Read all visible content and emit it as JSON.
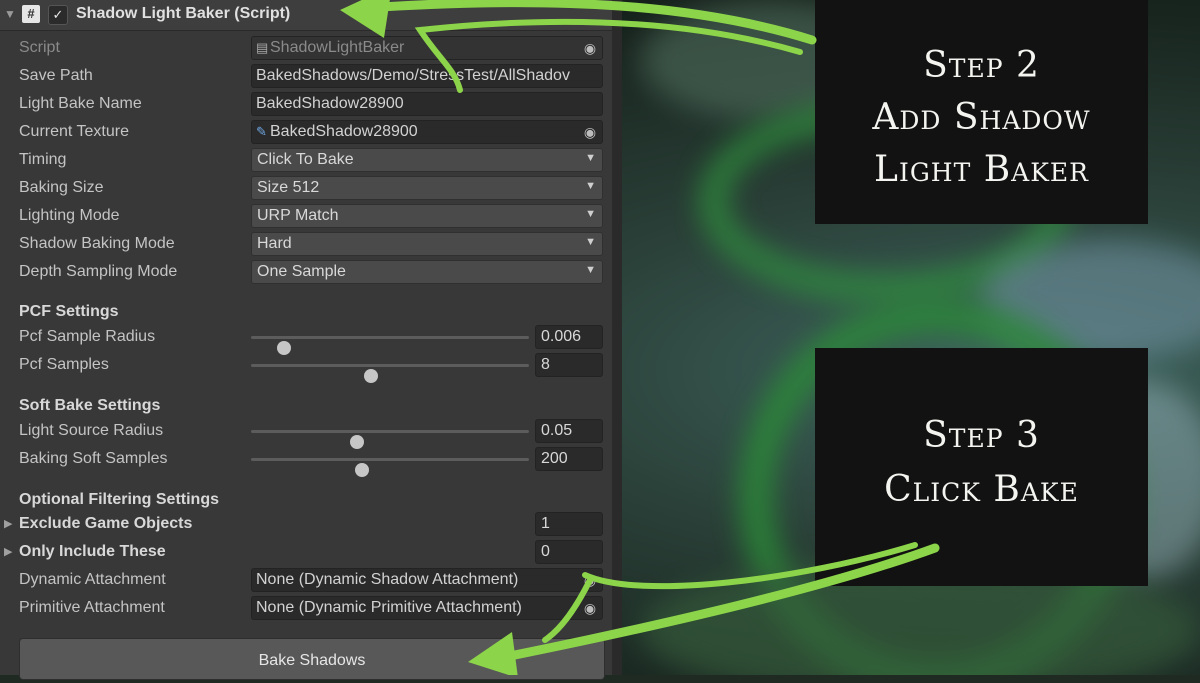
{
  "component": {
    "title": "Shadow Light Baker (Script)",
    "enabled": true
  },
  "fields": {
    "script": {
      "label": "Script",
      "value": "ShadowLightBaker"
    },
    "save_path": {
      "label": "Save Path",
      "value": "BakedShadows/Demo/StressTest/AllShadov"
    },
    "light_bake_name": {
      "label": "Light Bake Name",
      "value": "BakedShadow28900"
    },
    "current_texture": {
      "label": "Current Texture",
      "value": "BakedShadow28900"
    },
    "timing": {
      "label": "Timing",
      "value": "Click To Bake"
    },
    "baking_size": {
      "label": "Baking Size",
      "value": "Size 512"
    },
    "lighting_mode": {
      "label": "Lighting Mode",
      "value": "URP Match"
    },
    "shadow_baking_mode": {
      "label": "Shadow Baking Mode",
      "value": "Hard"
    },
    "depth_sampling_mode": {
      "label": "Depth Sampling Mode",
      "value": "One Sample"
    }
  },
  "pcf": {
    "heading": "PCF Settings",
    "sample_radius": {
      "label": "Pcf Sample Radius",
      "value": "0.006",
      "slider_fraction": 0.12
    },
    "samples": {
      "label": "Pcf Samples",
      "value": "8",
      "slider_fraction": 0.43
    }
  },
  "soft_bake": {
    "heading": "Soft Bake Settings",
    "light_source_radius": {
      "label": "Light Source Radius",
      "value": "0.05",
      "slider_fraction": 0.38
    },
    "soft_samples": {
      "label": "Baking Soft Samples",
      "value": "200",
      "slider_fraction": 0.4
    }
  },
  "filtering": {
    "heading": "Optional Filtering Settings",
    "exclude": {
      "label": "Exclude Game Objects",
      "value": "1"
    },
    "only_include": {
      "label": "Only Include These",
      "value": "0"
    },
    "dynamic_attachment": {
      "label": "Dynamic Attachment",
      "value": "None (Dynamic Shadow Attachment)"
    },
    "primitive_attachment": {
      "label": "Primitive Attachment",
      "value": "None (Dynamic Primitive Attachment)"
    }
  },
  "bake_button": "Bake Shadows",
  "steps": {
    "step2": [
      "Step 2",
      "Add Shadow",
      "Light Baker"
    ],
    "step3": [
      "Step 3",
      "Click Bake"
    ]
  },
  "colors": {
    "arrow": "#8cd44a",
    "panel": "#383838",
    "step_bg": "#111211"
  },
  "icons": {
    "script": "script-file-icon",
    "texture": "texture-icon",
    "picker": "object-picker-icon"
  }
}
